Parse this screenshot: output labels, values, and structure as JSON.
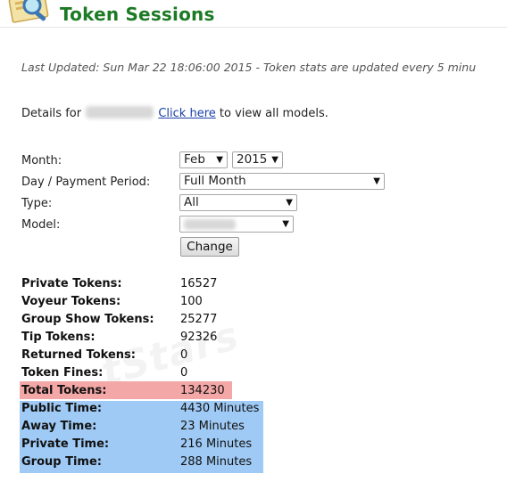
{
  "header": {
    "title": "Token Sessions"
  },
  "last_updated": "Last Updated: Sun Mar 22 18:06:00 2015 - Token stats are updated every 5 minu",
  "details": {
    "prefix": "Details for",
    "link": "Click here",
    "suffix": "to view all models."
  },
  "form": {
    "month_label": "Month:",
    "month_value": "Feb",
    "year_value": "2015",
    "period_label": "Day / Payment Period:",
    "period_value": "Full Month",
    "type_label": "Type:",
    "type_value": "All",
    "model_label": "Model:",
    "change_button": "Change"
  },
  "stats": [
    {
      "label": "Private Tokens:",
      "value": "16527"
    },
    {
      "label": "Voyeur Tokens:",
      "value": "100"
    },
    {
      "label": "Group Show Tokens:",
      "value": "25277"
    },
    {
      "label": "Tip Tokens:",
      "value": "92326"
    },
    {
      "label": "Returned Tokens:",
      "value": "0"
    },
    {
      "label": "Token Fines:",
      "value": "0"
    },
    {
      "label": "Total Tokens:",
      "value": "134230"
    },
    {
      "label": "Public Time:",
      "value": "4430 Minutes"
    },
    {
      "label": "Away Time:",
      "value": "23 Minutes"
    },
    {
      "label": "Private Time:",
      "value": "216 Minutes"
    },
    {
      "label": "Group Time:",
      "value": "288 Minutes"
    }
  ],
  "watermark": "tStars",
  "colors": {
    "title": "#1d7a25",
    "link": "#1a3fa8",
    "total_highlight": "#f4a7a7",
    "time_highlight": "#9fcaf5"
  },
  "icons": {
    "logo": "magnifier-document-icon",
    "dropdown": "triangle-down-icon"
  }
}
